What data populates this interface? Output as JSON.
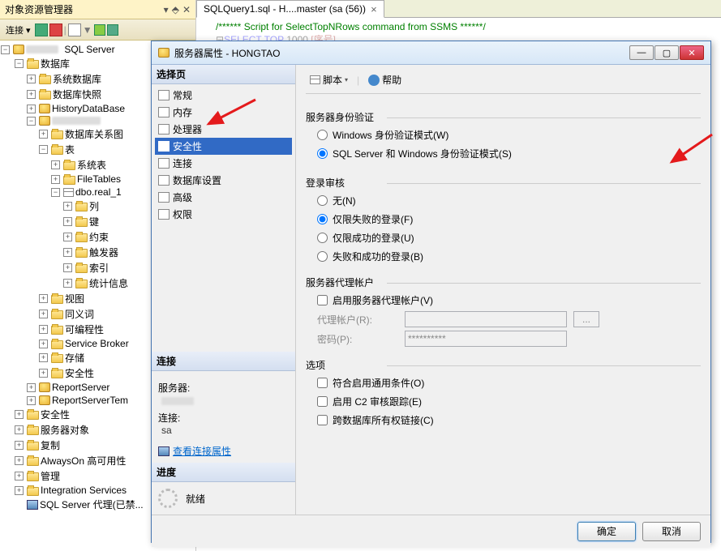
{
  "explorer": {
    "title": "对象资源管理器",
    "connect_label": "连接 ▾",
    "root_label": "SQL Server",
    "nodes": {
      "databases": "数据库",
      "sys_db": "系统数据库",
      "db_snapshot": "数据库快照",
      "history_db": "HistoryDataBase",
      "custom_db_blur": true,
      "diagrams": "数据库关系图",
      "tables": "表",
      "sys_tables": "系统表",
      "filetables": "FileTables",
      "dbo_real": "dbo.real_1",
      "columns": "列",
      "keys": "键",
      "constraints": "约束",
      "triggers": "触发器",
      "indexes": "索引",
      "stats": "统计信息",
      "views": "视图",
      "synonyms": "同义词",
      "programmability": "可编程性",
      "service_broker": "Service Broker",
      "storage": "存储",
      "security_db": "安全性",
      "report_server": "ReportServer",
      "report_server_temp": "ReportServerTem",
      "security": "安全性",
      "server_objects": "服务器对象",
      "replication": "复制",
      "alwayson": "AlwaysOn 高可用性",
      "management": "管理",
      "integration": "Integration Services",
      "agent": "SQL Server 代理(已禁..."
    }
  },
  "main": {
    "tab_label": "SQLQuery1.sql - H....master (sa (56))",
    "code_comment": "/****** Script for SelectTopNRows command from SSMS  ******/",
    "code_line2_kw": "SELECT TOP",
    "code_line2_num": "1000",
    "code_line2_col": "[序号]"
  },
  "dialog": {
    "title": "服务器属性 - HONGTAO",
    "select_page": "选择页",
    "pages": [
      "常规",
      "内存",
      "处理器",
      "安全性",
      "连接",
      "数据库设置",
      "高级",
      "权限"
    ],
    "selected_page_index": 3,
    "connection_section": "连接",
    "server_label": "服务器:",
    "connection_label": "连接:",
    "connection_value": "sa",
    "view_conn_props": "查看连接属性",
    "progress_section": "进度",
    "progress_status": "就绪",
    "script_btn": "脚本",
    "help_btn": "帮助",
    "auth_section": "服务器身份验证",
    "auth_windows": "Windows 身份验证模式(W)",
    "auth_mixed": "SQL Server 和 Windows 身份验证模式(S)",
    "audit_section": "登录审核",
    "audit_none": "无(N)",
    "audit_failed": "仅限失败的登录(F)",
    "audit_success": "仅限成功的登录(U)",
    "audit_both": "失败和成功的登录(B)",
    "proxy_section": "服务器代理帐户",
    "proxy_enable": "启用服务器代理帐户(V)",
    "proxy_account_label": "代理帐户(R):",
    "proxy_password_label": "密码(P):",
    "proxy_password_value": "**********",
    "options_section": "选项",
    "opt_common_criteria": "符合启用通用条件(O)",
    "opt_c2": "启用 C2 审核跟踪(E)",
    "opt_cross_db": "跨数据库所有权链接(C)",
    "ok_btn": "确定",
    "cancel_btn": "取消"
  }
}
